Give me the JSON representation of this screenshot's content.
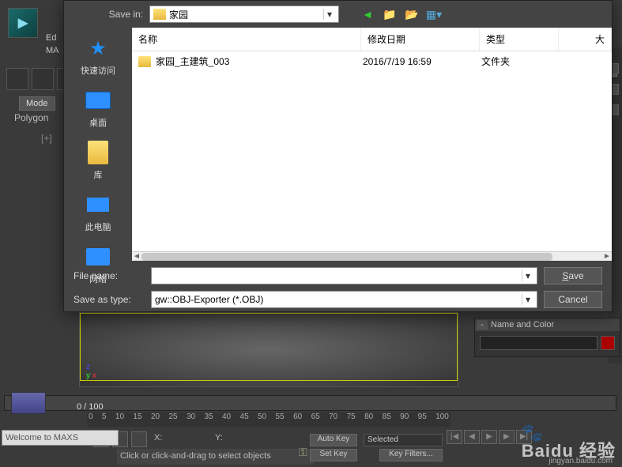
{
  "app": {
    "title1": "Ed",
    "title2": "MA",
    "mode_button": "Mode",
    "polygon_label": "Polygon",
    "plus_label": "[+]"
  },
  "dialog": {
    "save_in_label": "Save in:",
    "save_in_value": "家园",
    "places": {
      "quick": "快速访问",
      "desktop": "桌面",
      "library": "库",
      "this_pc": "此电脑",
      "network": "网络"
    },
    "columns": {
      "name": "名称",
      "date": "修改日期",
      "type": "类型",
      "size": "大"
    },
    "rows": [
      {
        "name": "家园_主建筑_003",
        "date": "2016/7/19 16:59",
        "type": "文件夹",
        "size": ""
      }
    ],
    "file_name_label": "File name:",
    "file_name_value": "",
    "save_as_type_label": "Save as type:",
    "save_as_type_value": "gw::OBJ-Exporter (*.OBJ)",
    "save_button": "Save",
    "cancel_button": "Cancel"
  },
  "timeline": {
    "position_label": "0 / 100",
    "ticks": [
      "0",
      "5",
      "10",
      "15",
      "20",
      "25",
      "30",
      "35",
      "40",
      "45",
      "50",
      "55",
      "60",
      "65",
      "70",
      "75",
      "80",
      "85",
      "90",
      "95",
      "100"
    ]
  },
  "status": {
    "welcome": "Welcome to MAXS",
    "hint": "Click or click-and-drag to select objects",
    "x_label": "X:",
    "y_label": "Y:",
    "autokey": "Auto Key",
    "setkey": "Set Key",
    "selected": "Selected",
    "keyfilters": "Key Filters..."
  },
  "right_panel": {
    "header": "Name and Color",
    "ea_label": "ea"
  },
  "watermark": {
    "brand": "Baidu 经验",
    "url": "jingyan.baidu.com"
  }
}
